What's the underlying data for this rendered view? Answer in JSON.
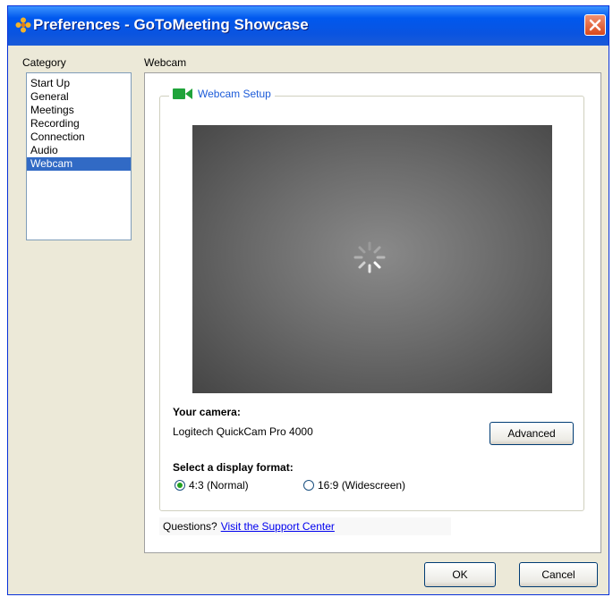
{
  "window": {
    "title": "Preferences - GoToMeeting Showcase",
    "app_icon": "gotomeeting-flower-icon",
    "close_icon": "close-icon",
    "close_color": "#d8481c"
  },
  "category": {
    "label": "Category",
    "items": [
      "Start Up",
      "General",
      "Meetings",
      "Recording",
      "Connection",
      "Audio",
      "Webcam"
    ],
    "selected": "Webcam",
    "selected_color": "#316ac5"
  },
  "panel": {
    "title": "Webcam",
    "group_title": "Webcam Setup",
    "group_icon": "webcam-icon",
    "group_icon_color": "#1fa33a",
    "preview": {
      "state": "loading",
      "spinner_icon": "loading-spinner-icon"
    },
    "camera_label": "Your camera:",
    "camera_name": "Logitech QuickCam Pro 4000",
    "advanced_button": "Advanced",
    "format_label": "Select a display format:",
    "formats": [
      {
        "label": "4:3 (Normal)",
        "selected": true
      },
      {
        "label": "16:9 (Widescreen)",
        "selected": false
      }
    ],
    "support": {
      "question": "Questions?",
      "link": "Visit the Support Center"
    }
  },
  "buttons": {
    "ok": "OK",
    "cancel": "Cancel"
  }
}
